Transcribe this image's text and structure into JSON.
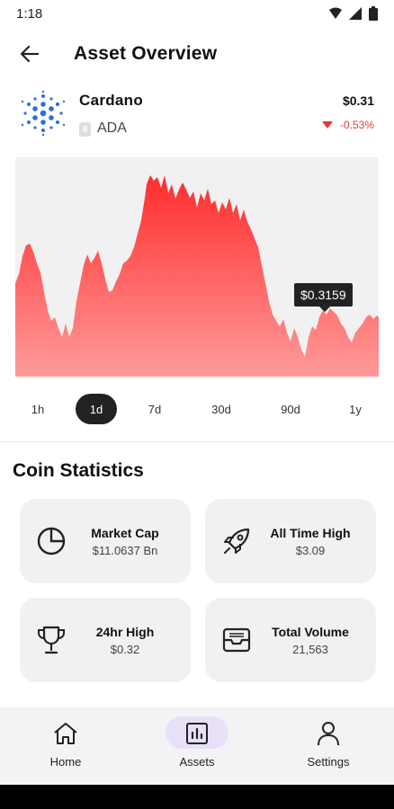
{
  "status": {
    "time": "1:18"
  },
  "header": {
    "title": "Asset Overview"
  },
  "coin": {
    "name": "Cardano",
    "rank": "8",
    "symbol": "ADA",
    "price": "$0.31",
    "change": "-0.53%"
  },
  "chart": {
    "tooltip": "$0.3159",
    "fill_color": "#ff5a5a"
  },
  "ranges": [
    "1h",
    "1d",
    "7d",
    "30d",
    "90d",
    "1y"
  ],
  "selected_range": "1d",
  "stats": {
    "title": "Coin Statistics",
    "cards": [
      {
        "title": "Market Cap",
        "value": "$11.0637 Bn",
        "icon": "pie-chart-icon"
      },
      {
        "title": "All Time High",
        "value": "$3.09",
        "icon": "rocket-icon"
      },
      {
        "title": "24hr High",
        "value": "$0.32",
        "icon": "trophy-icon"
      },
      {
        "title": "Total Volume",
        "value": "21,563",
        "icon": "inbox-icon"
      }
    ]
  },
  "nav": {
    "items": [
      {
        "label": "Home",
        "icon": "home-icon"
      },
      {
        "label": "Assets",
        "icon": "bar-chart-icon"
      },
      {
        "label": "Settings",
        "icon": "person-icon"
      }
    ],
    "selected": "Assets"
  },
  "colors": {
    "accent_negative": "#e53935",
    "nav_pill": "#e7e0f7"
  }
}
